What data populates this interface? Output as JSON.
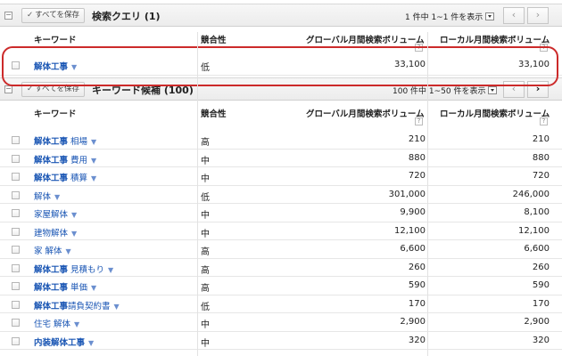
{
  "top_bar": {
    "save_all_label": "すべてを保存",
    "title": "検索クエリ (1)",
    "pager_text": "1 件中 1~1 件を表示"
  },
  "second_bar": {
    "save_all_label": "すべてを保存",
    "title": "キーワード候補 (100)",
    "pager_text": "100 件中 1~50 件を表示"
  },
  "columns": {
    "keyword": "キーワード",
    "competition": "競合性",
    "global_volume": "グローバル月間検索ボリューム",
    "local_volume": "ローカル月間検索ボリューム",
    "help": "?"
  },
  "query_row": {
    "keyword_bold": "解体工事",
    "keyword_rest": "",
    "competition": "低",
    "global": "33,100",
    "local": "33,100"
  },
  "rows": [
    {
      "keyword_bold": "解体工事",
      "keyword_rest": " 相場",
      "competition": "高",
      "global": "210",
      "local": "210"
    },
    {
      "keyword_bold": "解体工事",
      "keyword_rest": " 費用",
      "competition": "中",
      "global": "880",
      "local": "880"
    },
    {
      "keyword_bold": "解体工事",
      "keyword_rest": " 積算",
      "competition": "中",
      "global": "720",
      "local": "720"
    },
    {
      "keyword_bold": "",
      "keyword_rest": "解体",
      "competition": "低",
      "global": "301,000",
      "local": "246,000"
    },
    {
      "keyword_bold": "",
      "keyword_rest": "家屋解体",
      "competition": "中",
      "global": "9,900",
      "local": "8,100"
    },
    {
      "keyword_bold": "",
      "keyword_rest": "建物解体",
      "competition": "中",
      "global": "12,100",
      "local": "12,100"
    },
    {
      "keyword_bold": "",
      "keyword_rest": "家 解体",
      "competition": "高",
      "global": "6,600",
      "local": "6,600"
    },
    {
      "keyword_bold": "解体工事",
      "keyword_rest": " 見積もり",
      "competition": "高",
      "global": "260",
      "local": "260"
    },
    {
      "keyword_bold": "解体工事",
      "keyword_rest": " 単価",
      "competition": "高",
      "global": "590",
      "local": "590"
    },
    {
      "keyword_bold": "解体工事",
      "keyword_rest": "請負契約書",
      "competition": "低",
      "global": "170",
      "local": "170"
    },
    {
      "keyword_bold": "",
      "keyword_rest": "住宅 解体",
      "competition": "中",
      "global": "2,900",
      "local": "2,900"
    },
    {
      "keyword_bold": "内装解体工事",
      "keyword_rest": "",
      "competition": "中",
      "global": "320",
      "local": "320"
    }
  ],
  "colors": {
    "link": "#1a56b4",
    "highlight": "#cc2a2a"
  }
}
